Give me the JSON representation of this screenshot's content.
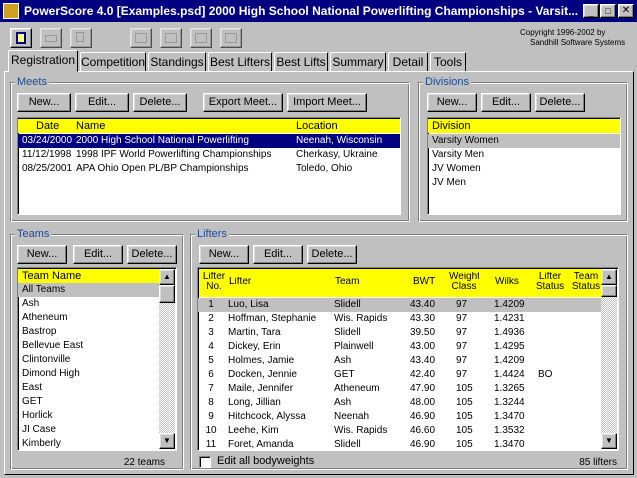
{
  "window": {
    "title": "PowerScore 4.0 [Examples.psd] 2000 High School National Powerlifting Championships - Varsit...",
    "copyright1": "Copyright 1996-2002 by",
    "copyright2": "Sandhill Software Systems"
  },
  "tabs": [
    "Registration",
    "Competition",
    "Standings",
    "Best Lifters",
    "Best Lifts",
    "Summary",
    "Detail",
    "Tools"
  ],
  "meets": {
    "title": "Meets",
    "buttons": {
      "new": "New...",
      "edit": "Edit...",
      "delete": "Delete...",
      "export": "Export Meet...",
      "import": "Import Meet..."
    },
    "headers": {
      "date": "Date",
      "name": "Name",
      "location": "Location"
    },
    "rows": [
      [
        "03/24/2000",
        "2000 High School National Powerlifting",
        "Neenah, Wisconsin"
      ],
      [
        "11/12/1998",
        "1998 IPF World Powerlifting Championships",
        "Cherkasy, Ukraine"
      ],
      [
        "08/25/2001",
        "APA Ohio Open PL/BP Championships",
        "Toledo, Ohio"
      ]
    ]
  },
  "divisions": {
    "title": "Divisions",
    "buttons": {
      "new": "New...",
      "edit": "Edit...",
      "delete": "Delete..."
    },
    "header": "Division",
    "rows": [
      "Varsity Women",
      "Varsity Men",
      "JV Women",
      "JV Men"
    ]
  },
  "teams": {
    "title": "Teams",
    "buttons": {
      "new": "New...",
      "edit": "Edit...",
      "delete": "Delete..."
    },
    "header": "Team Name",
    "rows": [
      "All Teams",
      "Ash",
      "Atheneum",
      "Bastrop",
      "Bellevue East",
      "Clintonville",
      "Dimond High",
      "East",
      "GET",
      "Horlick",
      "JI Case",
      "Kimberly"
    ],
    "count": "22 teams"
  },
  "lifters": {
    "title": "Lifters",
    "buttons": {
      "new": "New...",
      "edit": "Edit...",
      "delete": "Delete..."
    },
    "headers": {
      "no": "Lifter No.",
      "lifter": "Lifter",
      "team": "Team",
      "bwt": "BWT",
      "wclass": "Weight Class",
      "wilks": "Wilks",
      "status": "Lifter Status",
      "tstatus": "Team Status"
    },
    "rows": [
      [
        "1",
        "Luo, Lisa",
        "Slidell",
        "43.40",
        "97",
        "1.4209",
        ""
      ],
      [
        "2",
        "Hoffman, Stephanie",
        "Wis. Rapids",
        "43.30",
        "97",
        "1.4231",
        ""
      ],
      [
        "3",
        "Martin, Tara",
        "Slidell",
        "39.50",
        "97",
        "1.4936",
        ""
      ],
      [
        "4",
        "Dickey, Erin",
        "Plainwell",
        "43.00",
        "97",
        "1.4295",
        ""
      ],
      [
        "5",
        "Holmes, Jamie",
        "Ash",
        "43.40",
        "97",
        "1.4209",
        ""
      ],
      [
        "6",
        "Docken, Jennie",
        "GET",
        "42.40",
        "97",
        "1.4424",
        "BO"
      ],
      [
        "7",
        "Maile, Jennifer",
        "Atheneum",
        "47.90",
        "105",
        "1.3265",
        ""
      ],
      [
        "8",
        "Long, Jillian",
        "Ash",
        "48.00",
        "105",
        "1.3244",
        ""
      ],
      [
        "9",
        "Hitchcock, Alyssa",
        "Neenah",
        "46.90",
        "105",
        "1.3470",
        ""
      ],
      [
        "10",
        "Leehe, Kim",
        "Wis. Rapids",
        "46.60",
        "105",
        "1.3532",
        ""
      ],
      [
        "11",
        "Foret, Amanda",
        "Slidell",
        "46.90",
        "105",
        "1.3470",
        ""
      ]
    ],
    "edit_all": "Edit all bodyweights",
    "count": "85 lifters"
  }
}
